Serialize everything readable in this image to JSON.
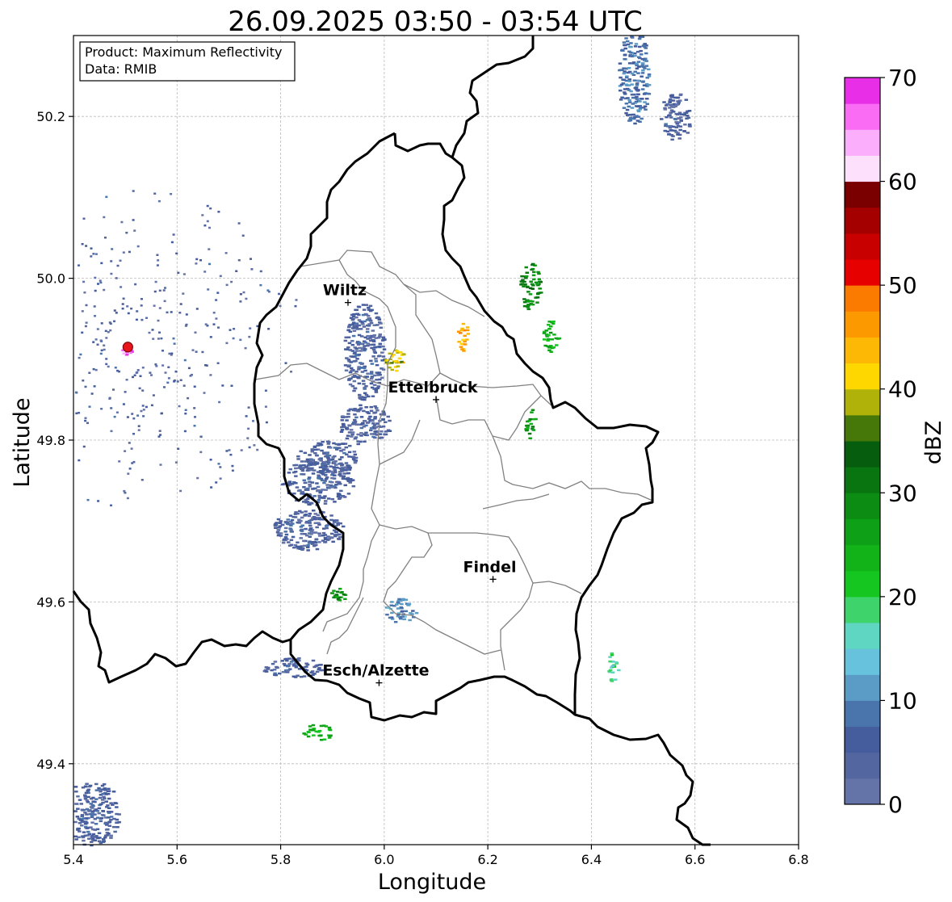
{
  "title": "26.09.2025 03:50 - 03:54 UTC",
  "info": {
    "product": "Product: Maximum Reflectivity",
    "data": "Data: RMIB"
  },
  "axes": {
    "xlabel": "Longitude",
    "ylabel": "Latitude",
    "xlim": [
      5.4,
      6.8
    ],
    "ylim": [
      49.3,
      50.3
    ],
    "xticks": [
      5.4,
      5.6,
      5.8,
      6.0,
      6.2,
      6.4,
      6.6,
      6.8
    ],
    "xtick_labels": [
      "5.4",
      "5.6",
      "5.8",
      "6.0",
      "6.2",
      "6.4",
      "6.6",
      "6.8"
    ],
    "yticks": [
      49.4,
      49.6,
      49.8,
      50.0,
      50.2
    ],
    "ytick_labels": [
      "49.4",
      "49.6",
      "49.8",
      "50.0",
      "50.2"
    ],
    "grid": true
  },
  "cities": [
    {
      "name": "Wiltz",
      "lon": 5.93,
      "lat": 49.97
    },
    {
      "name": "Ettelbruck",
      "lon": 6.1,
      "lat": 49.85
    },
    {
      "name": "Findel",
      "lon": 6.21,
      "lat": 49.628
    },
    {
      "name": "Esch/Alzette",
      "lon": 5.99,
      "lat": 49.5
    }
  ],
  "radar_site": {
    "lon": 5.505,
    "lat": 49.915,
    "color": "#e8141b"
  },
  "colorbar": {
    "label": "dBZ",
    "min": 0,
    "max": 70,
    "step": 2.5,
    "ticks": [
      0,
      10,
      20,
      30,
      40,
      50,
      60,
      70
    ],
    "tick_labels": [
      "0",
      "10",
      "20",
      "30",
      "40",
      "50",
      "60",
      "70"
    ],
    "colors": [
      "#6474a8",
      "#5466a0",
      "#455c9d",
      "#4a75ac",
      "#5b9cc6",
      "#66c2dd",
      "#5fd6c1",
      "#3ed36b",
      "#14c61f",
      "#11b318",
      "#0ea016",
      "#0c8c13",
      "#097511",
      "#065d0d",
      "#457808",
      "#b0b20a",
      "#ffd700",
      "#fdb805",
      "#fc9800",
      "#fb7b00",
      "#e60000",
      "#c80000",
      "#a40000",
      "#7a0000",
      "#fce0fc",
      "#fbaefb",
      "#f96cf3",
      "#e92ee8"
    ]
  },
  "echo_cells": [
    {
      "lon": 5.87,
      "lat": 49.75,
      "rx": 0.07,
      "ry": 0.03,
      "dbz": 5
    },
    {
      "lon": 5.85,
      "lat": 49.69,
      "rx": 0.07,
      "ry": 0.025,
      "dbz": 5
    },
    {
      "lon": 5.89,
      "lat": 49.78,
      "rx": 0.06,
      "ry": 0.02,
      "dbz": 5
    },
    {
      "lon": 5.96,
      "lat": 49.82,
      "rx": 0.05,
      "ry": 0.025,
      "dbz": 5
    },
    {
      "lon": 6.03,
      "lat": 49.59,
      "rx": 0.03,
      "ry": 0.015,
      "dbz": 10
    },
    {
      "lon": 5.82,
      "lat": 49.52,
      "rx": 0.06,
      "ry": 0.012,
      "dbz": 5
    },
    {
      "lon": 5.96,
      "lat": 49.91,
      "rx": 0.04,
      "ry": 0.06,
      "dbz": 5
    },
    {
      "lon": 6.48,
      "lat": 50.25,
      "rx": 0.03,
      "ry": 0.06,
      "dbz": 8
    },
    {
      "lon": 6.56,
      "lat": 50.2,
      "rx": 0.03,
      "ry": 0.03,
      "dbz": 5
    },
    {
      "lon": 5.43,
      "lat": 49.34,
      "rx": 0.06,
      "ry": 0.04,
      "dbz": 5
    },
    {
      "lon": 6.28,
      "lat": 49.99,
      "rx": 0.02,
      "ry": 0.03,
      "dbz": 30
    },
    {
      "lon": 6.32,
      "lat": 49.93,
      "rx": 0.015,
      "ry": 0.02,
      "dbz": 25
    },
    {
      "lon": 6.02,
      "lat": 49.9,
      "rx": 0.02,
      "ry": 0.015,
      "dbz": 40
    },
    {
      "lon": 6.44,
      "lat": 49.52,
      "rx": 0.01,
      "ry": 0.02,
      "dbz": 18
    },
    {
      "lon": 5.87,
      "lat": 49.44,
      "rx": 0.03,
      "ry": 0.01,
      "dbz": 25
    },
    {
      "lon": 5.91,
      "lat": 49.61,
      "rx": 0.015,
      "ry": 0.008,
      "dbz": 28
    },
    {
      "lon": 6.15,
      "lat": 49.93,
      "rx": 0.01,
      "ry": 0.02,
      "dbz": 45
    },
    {
      "lon": 6.28,
      "lat": 49.82,
      "rx": 0.01,
      "ry": 0.02,
      "dbz": 28
    },
    {
      "lon": 5.5,
      "lat": 49.912,
      "rx": 0.01,
      "ry": 0.006,
      "dbz": 68
    }
  ]
}
